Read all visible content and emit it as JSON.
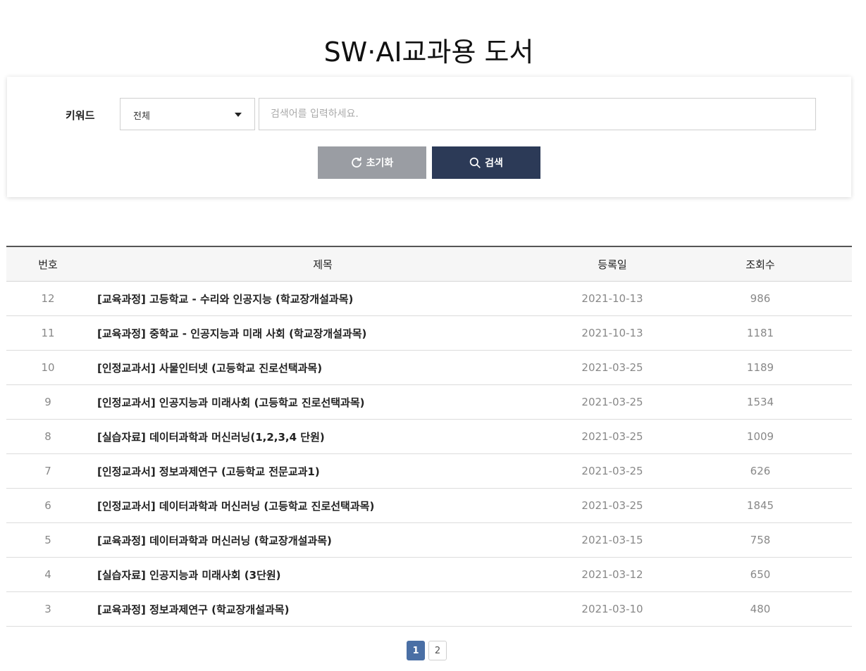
{
  "page": {
    "title": "SW·AI교과용 도서"
  },
  "search": {
    "keyword_label": "키워드",
    "select_value": "전체",
    "input_value": "",
    "input_placeholder": "검색어를 입력하세요.",
    "reset_label": "초기화",
    "search_label": "검색"
  },
  "table": {
    "headers": {
      "no": "번호",
      "title": "제목",
      "date": "등록일",
      "views": "조회수"
    },
    "rows": [
      {
        "no": "12",
        "title": "[교육과정] 고등학교 - 수리와 인공지능 (학교장개설과목)",
        "date": "2021-10-13",
        "views": "986"
      },
      {
        "no": "11",
        "title": "[교육과정] 중학교 - 인공지능과 미래 사회 (학교장개설과목)",
        "date": "2021-10-13",
        "views": "1181"
      },
      {
        "no": "10",
        "title": "[인정교과서] 사물인터넷 (고등학교 진로선택과목)",
        "date": "2021-03-25",
        "views": "1189"
      },
      {
        "no": "9",
        "title": "[인정교과서] 인공지능과 미래사회 (고등학교 진로선택과목)",
        "date": "2021-03-25",
        "views": "1534"
      },
      {
        "no": "8",
        "title": "[실습자료] 데이터과학과 머신러닝(1,2,3,4 단원)",
        "date": "2021-03-25",
        "views": "1009"
      },
      {
        "no": "7",
        "title": "[인정교과서] 정보과제연구 (고등학교 전문교과1)",
        "date": "2021-03-25",
        "views": "626"
      },
      {
        "no": "6",
        "title": "[인정교과서] 데이터과학과 머신러닝 (고등학교 진로선택과목)",
        "date": "2021-03-25",
        "views": "1845"
      },
      {
        "no": "5",
        "title": "[교육과정] 데이터과학과 머신러닝 (학교장개설과목)",
        "date": "2021-03-15",
        "views": "758"
      },
      {
        "no": "4",
        "title": "[실습자료] 인공지능과 미래사회 (3단원)",
        "date": "2021-03-12",
        "views": "650"
      },
      {
        "no": "3",
        "title": "[교육과정] 정보과제연구 (학교장개설과목)",
        "date": "2021-03-10",
        "views": "480"
      }
    ]
  },
  "pagination": {
    "pages": [
      "1",
      "2"
    ],
    "current": "1"
  },
  "colors": {
    "search_button": "#2c3a57",
    "reset_button": "#9a9da3",
    "active_page": "#4a6fa5"
  }
}
